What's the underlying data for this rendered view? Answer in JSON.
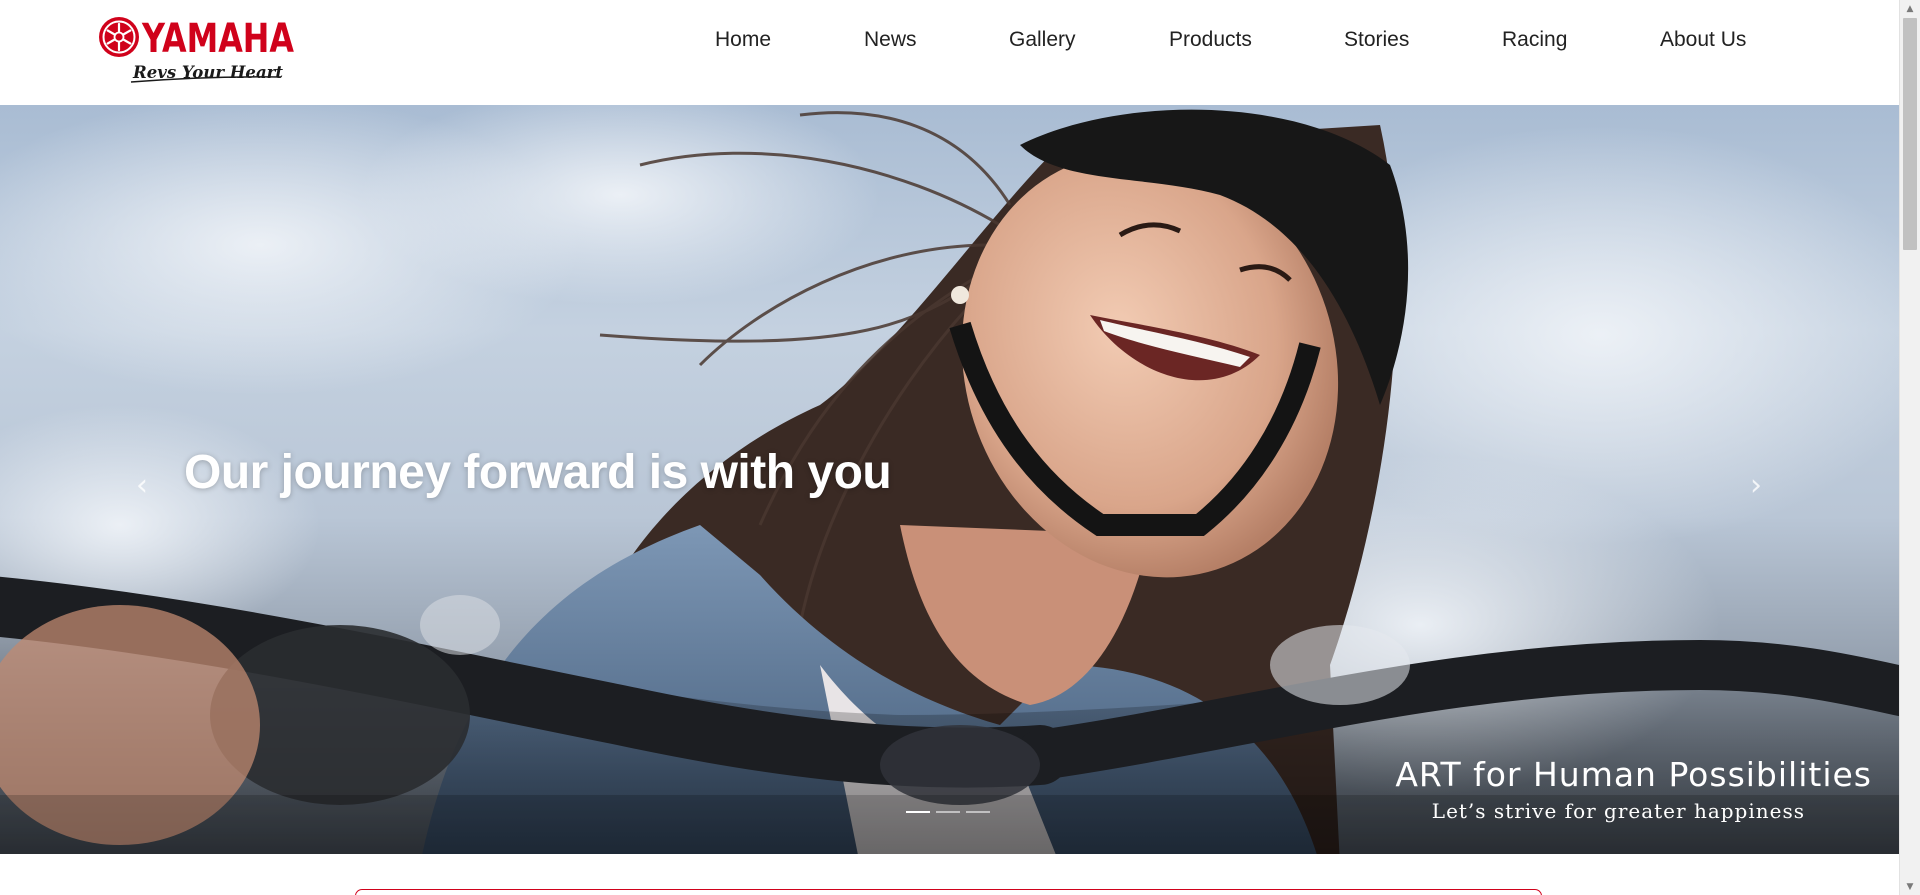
{
  "brand": {
    "name": "YAMAHA",
    "slogan": "Revs Your Heart",
    "colors": {
      "brand_red": "#d0021b",
      "text_dark": "#222222"
    }
  },
  "nav": {
    "items": [
      {
        "label": "Home"
      },
      {
        "label": "News"
      },
      {
        "label": "Gallery"
      },
      {
        "label": "Products"
      },
      {
        "label": "Stories"
      },
      {
        "label": "Racing"
      },
      {
        "label": "About Us"
      }
    ]
  },
  "hero": {
    "headline": "Our journey forward is with you",
    "prev_icon": "chevron-left-icon",
    "next_icon": "chevron-right-icon",
    "prev_glyph": "‹",
    "next_glyph": "›",
    "slides_total": 3,
    "active_slide": 1,
    "tagline_main": "ART for Human Possibilities",
    "tagline_sub": "Let’s strive for greater happiness"
  },
  "scrollbar": {
    "up_glyph": "▲",
    "down_glyph": "▼"
  }
}
